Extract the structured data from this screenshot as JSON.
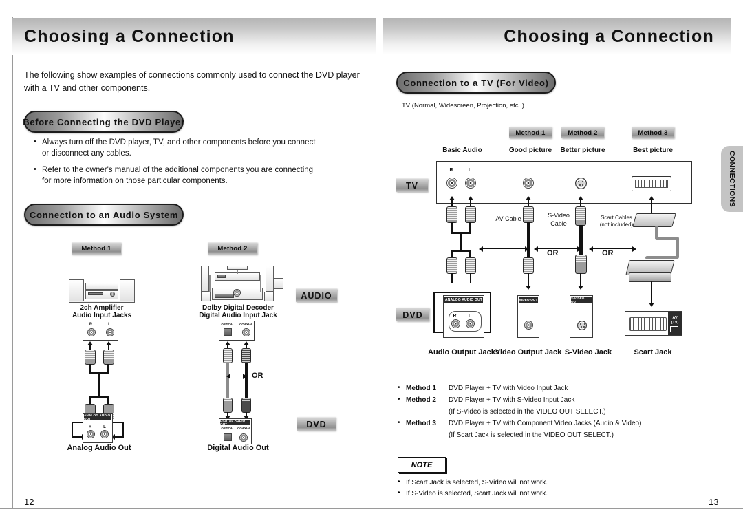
{
  "spread": {
    "left_page_number": "12",
    "right_page_number": "13",
    "side_tab_label": "CONNECTIONS"
  },
  "left_page": {
    "header_title": "Choosing a Connection",
    "intro": "The following show examples of connections commonly used to connect the DVD player with a TV and other components.",
    "section_before": {
      "heading": "Before Connecting the DVD Player",
      "bullets": [
        "Always turn off the DVD player, TV, and other components before you connect or disconnect any cables.",
        "Refer to the owner's manual of the additional components you are connecting for more information on those particular components."
      ]
    },
    "section_audio": {
      "heading": "Connection to an Audio System",
      "badge_audio": "AUDIO",
      "badge_dvd": "DVD",
      "or_label": "OR",
      "method1": {
        "badge": "Method 1",
        "device_caption_line1": "2ch Amplifier",
        "device_caption_line2": "Audio Input Jacks",
        "jack_r": "R",
        "jack_l": "L",
        "dvd_panel_title": "ANALOG AUDIO OUT",
        "dvd_jack_r": "R",
        "dvd_jack_l": "L",
        "bottom_caption": "Analog Audio Out"
      },
      "method2": {
        "badge": "Method 2",
        "device_caption_line1": "Dolby Digital Decoder",
        "device_caption_line2": "Digital Audio Input Jack",
        "jack_optical": "OPTICAL",
        "jack_coaxial": "COAXIAL",
        "dvd_panel_title": "DIGITAL AUDIO OUT",
        "dvd_jack_optical": "OPTICAL",
        "dvd_jack_coaxial": "COAXIAL",
        "bottom_caption": "Digital Audio Out"
      }
    }
  },
  "right_page": {
    "header_title": "Choosing a Connection",
    "section_tv": {
      "heading": "Connection to a TV (For Video)",
      "tv_types": "TV (Normal, Widescreen, Projection, etc..)",
      "badge_tv": "TV",
      "badge_dvd": "DVD",
      "columns": [
        {
          "badge": "",
          "quality": "Basic Audio"
        },
        {
          "badge": "Method 1",
          "quality": "Good picture"
        },
        {
          "badge": "Method 2",
          "quality": "Better picture"
        },
        {
          "badge": "Method 3",
          "quality": "Best picture"
        }
      ],
      "tv_jack_r": "R",
      "tv_jack_l": "L",
      "cable_labels": {
        "av": "AV Cable",
        "svideo_line1": "S-Video",
        "svideo_line2": "Cable",
        "scart_line1": "Scart Cables",
        "scart_line2": "(not included)"
      },
      "or_labels": [
        "OR",
        "OR"
      ],
      "dvd_panels": {
        "analog_title": "ANALOG AUDIO OUT",
        "analog_jack_r": "R",
        "analog_jack_l": "L",
        "video_title": "VIDEO OUT",
        "svideo_title": "S-VIDEO OUT",
        "scart_label_line1": "AV",
        "scart_label_line2": "(TV)"
      },
      "bottom_captions": [
        "Audio Output Jacks",
        "Video Output Jack",
        "S-Video Jack",
        "Scart Jack"
      ]
    },
    "method_list": [
      {
        "key": "Method 1",
        "text": "DVD Player + TV with Video Input Jack",
        "sub": ""
      },
      {
        "key": "Method 2",
        "text": "DVD Player + TV with S-Video Input Jack",
        "sub": "(If S-Video is selected in the VIDEO OUT SELECT.)"
      },
      {
        "key": "Method 3",
        "text": "DVD Player + TV with Component Video Jacks (Audio & Video)",
        "sub": "(If Scart Jack is selected in the VIDEO OUT SELECT.)"
      }
    ],
    "note": {
      "label": "NOTE",
      "items": [
        "If Scart Jack is selected, S-Video will not work.",
        "If S-Video is selected, Scart Jack will not work."
      ]
    }
  },
  "colors": {
    "banner_top": "#b4b4b4",
    "badge_grey": "#b5b5b5",
    "side_tab": "#c4c4c4",
    "ink": "#111111"
  }
}
